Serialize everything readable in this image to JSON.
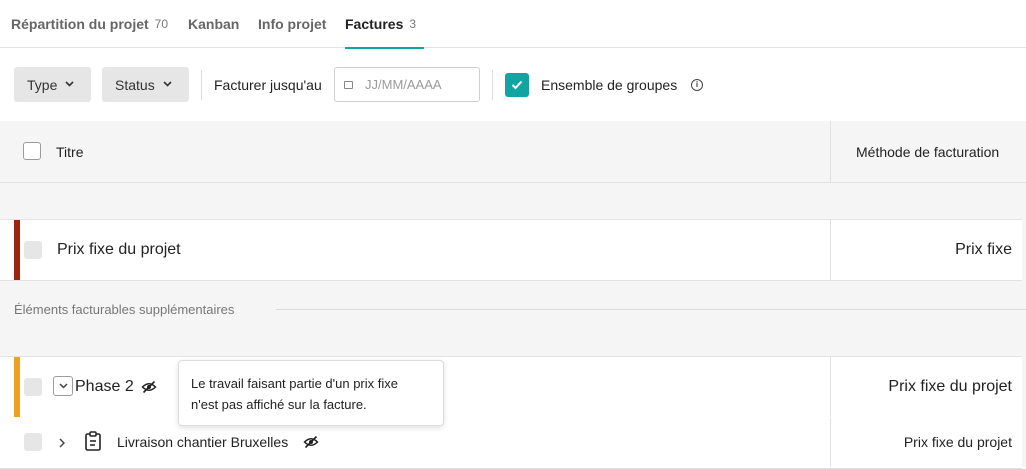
{
  "tabs": [
    {
      "label": "Répartition du projet",
      "count": "70"
    },
    {
      "label": "Kanban",
      "count": ""
    },
    {
      "label": "Info projet",
      "count": ""
    },
    {
      "label": "Factures",
      "count": "3"
    }
  ],
  "toolbar": {
    "type_label": "Type",
    "status_label": "Status",
    "bill_until_label": "Facturer jusqu'au",
    "date_placeholder": "JJ/MM/AAAA",
    "group_set_label": "Ensemble de groupes"
  },
  "table": {
    "col_title": "Titre",
    "col_billing_method": "Méthode de facturation",
    "fixed_row": {
      "title": "Prix fixe du projet",
      "method": "Prix fixe"
    },
    "section_label": "Éléments facturables supplémentaires",
    "phase_row": {
      "title": "Phase 2",
      "method": "Prix fixe du projet"
    },
    "task_row": {
      "title": "Livraison chantier Bruxelles",
      "method": "Prix fixe du projet"
    }
  },
  "tooltip": {
    "line1": "Le travail faisant partie d'un prix fixe",
    "line2": "n'est pas affiché sur la facture."
  },
  "colors": {
    "accent": "#12a3a3",
    "stripe_fixed": "#a0230f",
    "stripe_phase": "#f0a020"
  }
}
